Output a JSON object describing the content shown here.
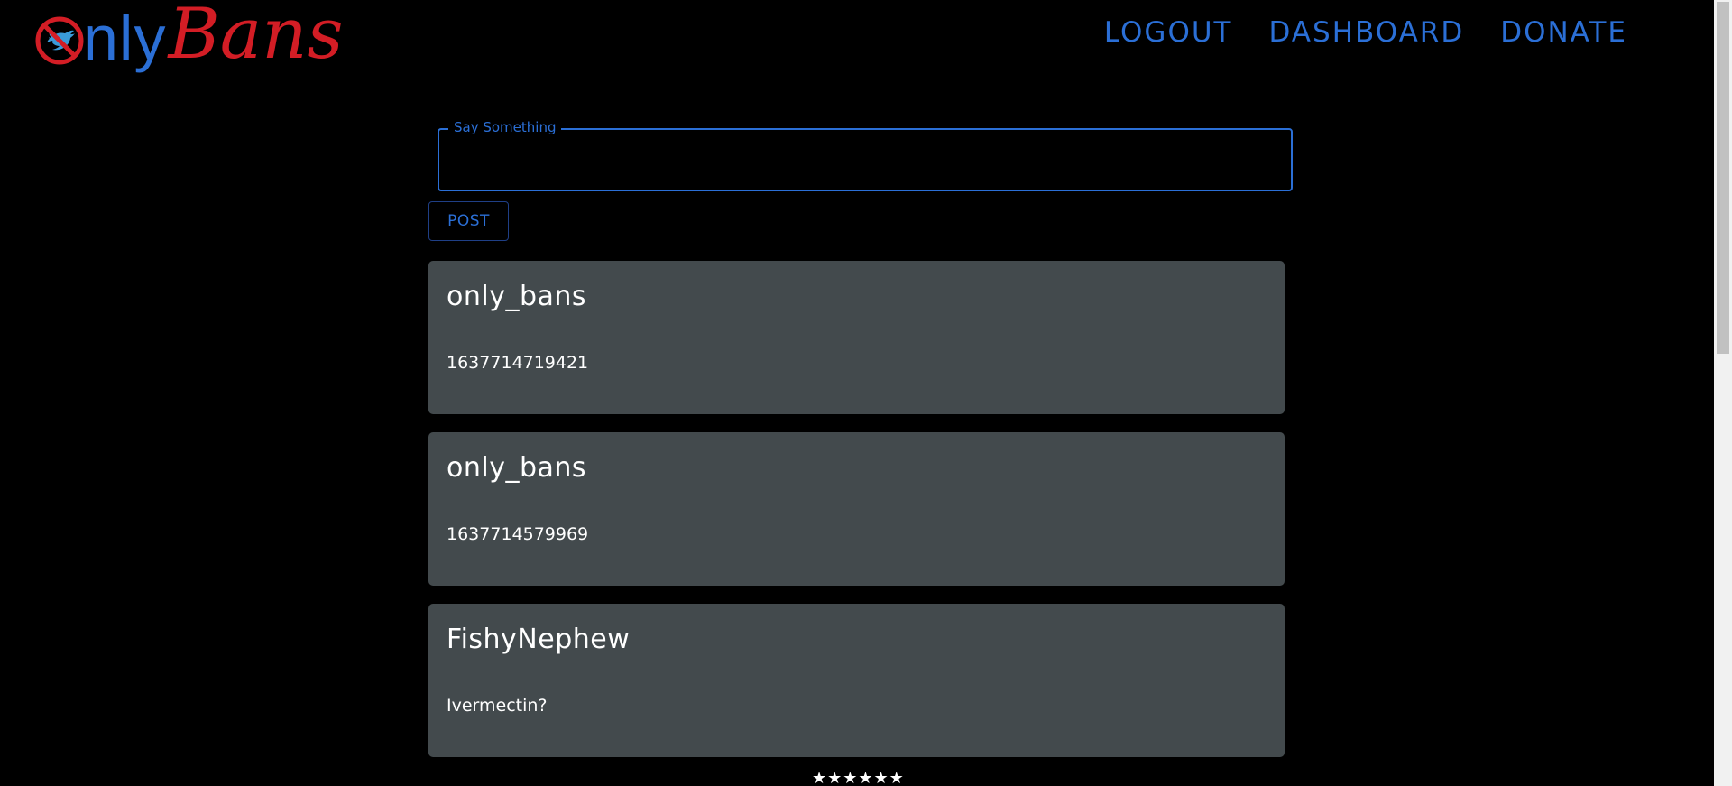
{
  "brand": {
    "logo_text_blue": "nly",
    "logo_text_red": "Bans",
    "blue": "#2b6fd6",
    "red": "#d31d25"
  },
  "nav": {
    "logout": "LOGOUT",
    "dashboard": "DASHBOARD",
    "donate": "DONATE"
  },
  "composer": {
    "label": "Say Something",
    "value": "",
    "post_label": "POST"
  },
  "posts": [
    {
      "author": "only_bans",
      "body": "1637714719421"
    },
    {
      "author": "only_bans",
      "body": "1637714579969"
    },
    {
      "author": "FishyNephew",
      "body": "Ivermectin?"
    }
  ],
  "rating": {
    "stars": "★★★★★★"
  },
  "colors": {
    "background": "#000000",
    "card": "#434a4d",
    "accent": "#2b6fd6"
  }
}
